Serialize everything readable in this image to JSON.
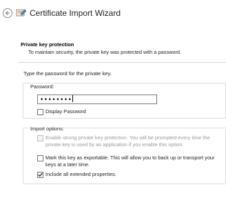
{
  "window": {
    "title": "Certificate Import Wizard"
  },
  "header": {
    "title": "Private key protection",
    "subtitle": "To maintain security, the private key was protected with a password."
  },
  "instruction": "Type the password for the private key.",
  "password_group": {
    "legend": "Password:",
    "password_masked": "••••••••",
    "display_password": {
      "label": "Display Password",
      "checked": false
    }
  },
  "import_options": {
    "legend": "Import options:",
    "strong_protection": {
      "label_line1": "Enable strong private key protection. You will be prompted every time the",
      "label_line2": "private key is used by an application if you enable this option.",
      "checked": false,
      "enabled": false
    },
    "exportable": {
      "label_line1": "Mark this key as exportable. This will allow you to back up or transport your",
      "label_line2": "keys at a later time.",
      "checked": false,
      "enabled": true
    },
    "extended_properties": {
      "label": "Include all extended properties.",
      "checked": true,
      "enabled": true
    }
  },
  "icons": {
    "back": "back-arrow-icon",
    "wizard": "certificate-wizard-icon",
    "check": "checkmark-icon"
  },
  "colors": {
    "group_border": "#d5dfe5",
    "disabled_text": "#9a9a9a"
  }
}
